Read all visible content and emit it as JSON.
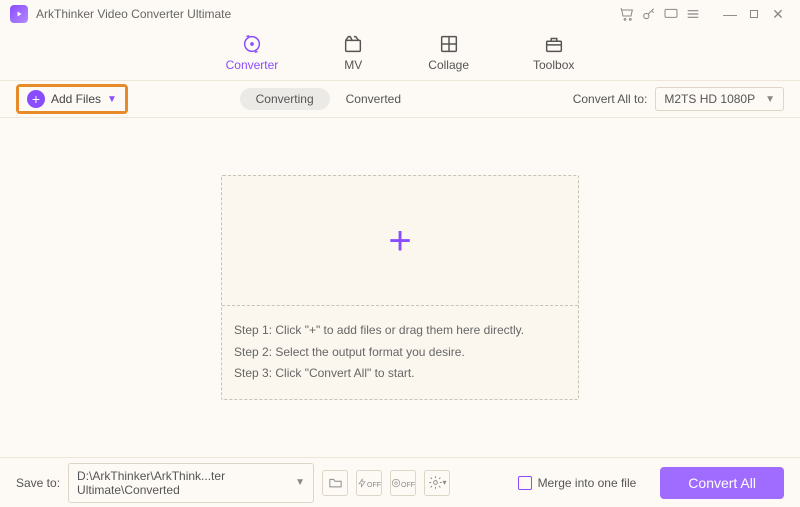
{
  "app": {
    "title": "ArkThinker Video Converter Ultimate"
  },
  "tabs": {
    "converter": "Converter",
    "mv": "MV",
    "collage": "Collage",
    "toolbox": "Toolbox"
  },
  "toolbar": {
    "addFiles": "Add Files",
    "converting": "Converting",
    "converted": "Converted",
    "convertAllToLabel": "Convert All to:",
    "formatSelected": "M2TS HD 1080P"
  },
  "steps": {
    "s1": "Step 1: Click \"+\" to add files or drag them here directly.",
    "s2": "Step 2: Select the output format you desire.",
    "s3": "Step 3: Click \"Convert All\" to start."
  },
  "footer": {
    "saveToLabel": "Save to:",
    "path": "D:\\ArkThinker\\ArkThink...ter Ultimate\\Converted",
    "mergeLabel": "Merge into one file",
    "convertAll": "Convert All"
  }
}
